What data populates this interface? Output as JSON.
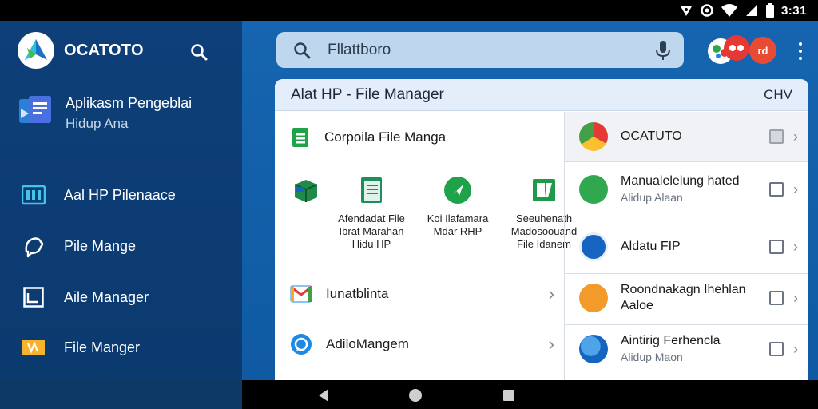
{
  "status_bar": {
    "time": "3:31"
  },
  "sidebar": {
    "brand": "OCATOTO",
    "app": {
      "title": "Aplikasm Pengeblai",
      "subtitle": "Hidup Ana"
    },
    "items": [
      {
        "label": "Aal HP Pilenaace",
        "icon": "storage-icon"
      },
      {
        "label": "Pile Mange",
        "icon": "bird-icon"
      },
      {
        "label": "Aile Manager",
        "icon": "image-icon"
      },
      {
        "label": "File Manger",
        "icon": "ticket-icon"
      }
    ]
  },
  "search": {
    "text": "Fllattboro"
  },
  "avatars": {
    "badge": "rd"
  },
  "panel": {
    "title": "Alat HP - File Manager",
    "right_label": "CHV",
    "left": {
      "section_title": "Corpoila File Manga",
      "grid": [
        {
          "lines": [],
          "icon": "box-icon"
        },
        {
          "lines": [
            "Afendadat File",
            "Ibrat Marahan",
            "Hidu HP"
          ],
          "icon": "document-icon"
        },
        {
          "lines": [
            "Koi Ilafamara",
            "Mdar RHP"
          ],
          "icon": "share-icon"
        },
        {
          "lines": [
            "Seeuhenath",
            "Madosoouand",
            "File Idanem"
          ],
          "icon": "folder-icon"
        }
      ],
      "rows": [
        {
          "label": "Iunatblinta",
          "icon": "gmail-icon"
        },
        {
          "label": "AdiloMangem",
          "icon": "chat-icon"
        }
      ]
    },
    "right": {
      "rows": [
        {
          "title": "OCATUTO",
          "subtitle": "",
          "icon": "chrome-icon",
          "checked": true
        },
        {
          "title": "Manualelelung hated",
          "subtitle": "Alidup Alaan",
          "icon": "book-icon",
          "checked": false
        },
        {
          "title": "Aldatu FIP",
          "subtitle": "",
          "icon": "people-icon",
          "checked": false
        },
        {
          "title": "Roondnakagn Ihehlan",
          "subtitle": "Aaloe",
          "icon": "cat-icon",
          "checked": false
        },
        {
          "title": "Aintirig Ferhencla",
          "subtitle": "Alidup Maon",
          "icon": "globe-icon",
          "checked": false
        }
      ]
    }
  },
  "colors": {
    "accent": "#0f5aa2",
    "sidebar": "#0e3f78",
    "status_bar": "#000000"
  }
}
